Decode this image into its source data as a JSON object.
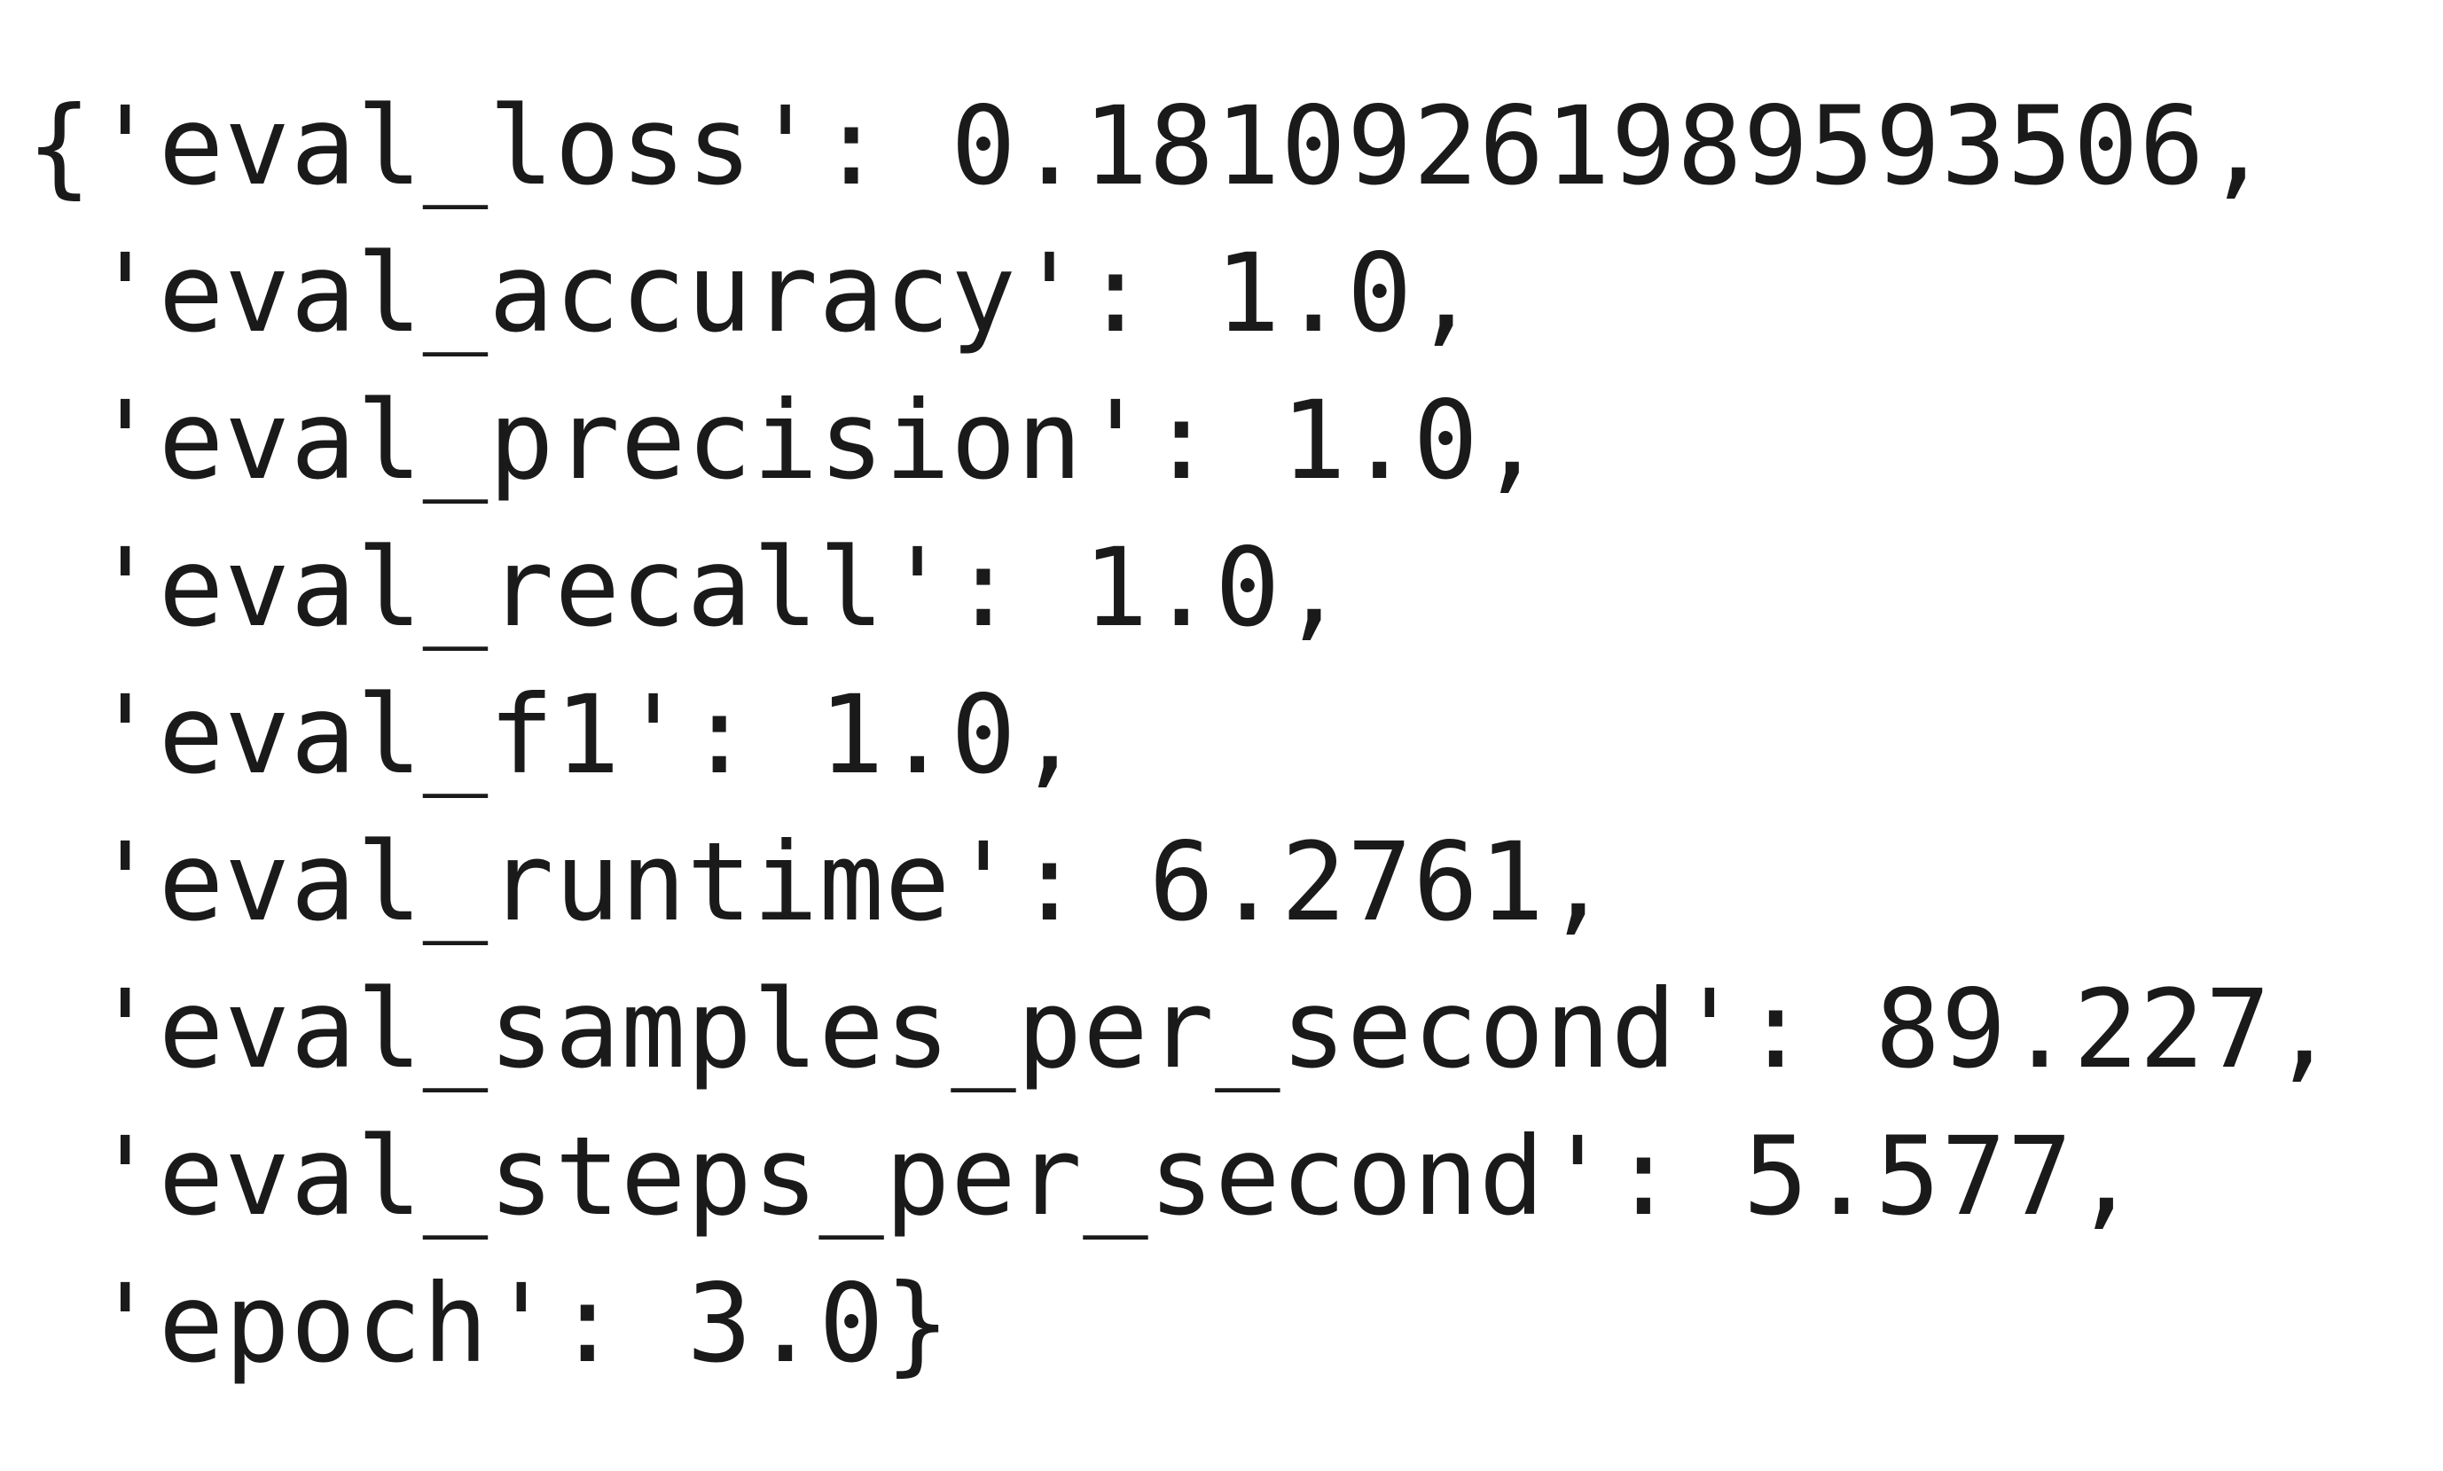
{
  "output": {
    "lines": [
      "{'eval_loss': 0.18109261989593506,",
      " 'eval_accuracy': 1.0,",
      " 'eval_precision': 1.0,",
      " 'eval_recall': 1.0,",
      " 'eval_f1': 1.0,",
      " 'eval_runtime': 6.2761,",
      " 'eval_samples_per_second': 89.227,",
      " 'eval_steps_per_second': 5.577,",
      " 'epoch': 3.0}"
    ]
  }
}
